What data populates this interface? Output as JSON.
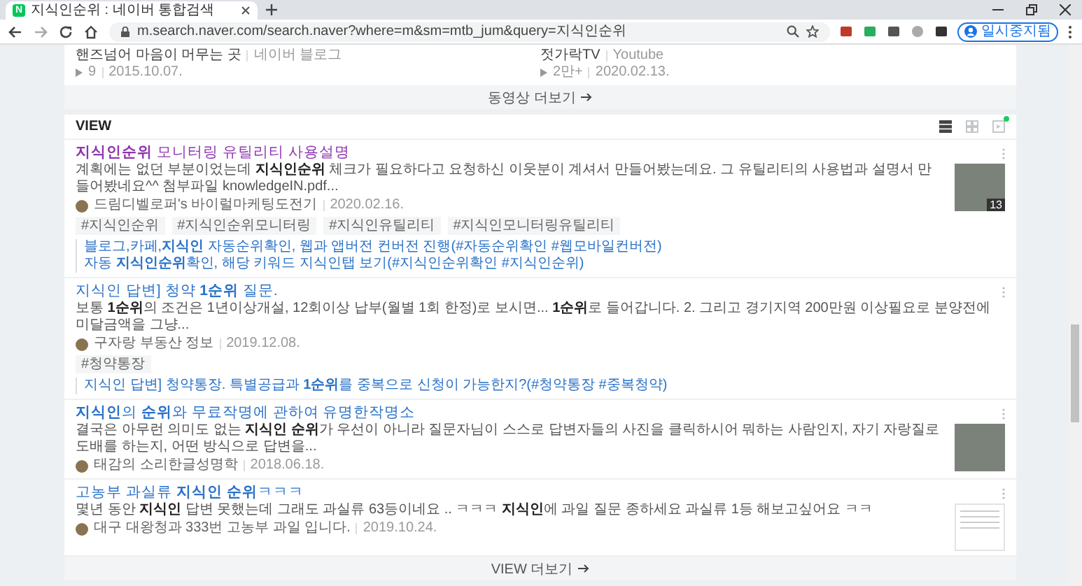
{
  "browser": {
    "tab": {
      "favicon": "N",
      "title": "지식인순위 : 네이버 통합검색"
    },
    "address": "m.search.naver.com/search.naver?where=m&sm=mtb_jum&query=지식인순위",
    "profile": "일시중지됨"
  },
  "video_results": {
    "items": [
      {
        "title": "핸즈넘어 마음이 머무는 곳",
        "source": "네이버 블로그",
        "plays": "9",
        "date": "2015.10.07."
      },
      {
        "title": "젓가락TV",
        "source": "Youtube",
        "plays": "2만+",
        "date": "2020.02.13."
      }
    ],
    "more_label": "동영상 더보기"
  },
  "view": {
    "title": "VIEW",
    "layout_modes": [
      {
        "kind": "list",
        "selected": true,
        "new": false
      },
      {
        "kind": "grid",
        "selected": false,
        "new": false
      },
      {
        "kind": "feed",
        "selected": false,
        "new": true
      }
    ],
    "items": [
      {
        "title": "**지식인순위** 모니터링 유틸리티 사용설명",
        "visited": true,
        "description": "계획에는 없던 부분이었는데 **지식인순위** 체크가 필요하다고 요청하신 이웃분이 계셔서 만들어봤는데요. 그 유틸리티의 사용법과 설명서 만들어봤네요^^ 첨부파일 knowledgeIN.pdf...",
        "author": "드림디벨로퍼's 바이럴마케팅도전기",
        "date": "2020.02.16.",
        "thumbnail": {
          "kind": "photo",
          "count": "13"
        },
        "tags": [
          "#지식인순위",
          "#지식인순위모니터링",
          "#지식인유틸리티",
          "#지식인모니터링유틸리티"
        ],
        "related": [
          "블로그,카페,**지식인** 자동순위확인, 웹과 앱버전 컨버전 진행(#자동순위확인 #웹모바일컨버전)",
          "자동 **지식인순위**확인, 해당 키워드 지식인탭 보기(#지식인순위확인 #지식인순위)"
        ]
      },
      {
        "title": "지식인 답변] 청약 **1순위** 질문.",
        "visited": false,
        "description": "보통 **1순위**의 조건은 1년이상개설, 12회이상 납부(월별 1회 한정)로 보시면... **1순위**로 들어갑니다. 2. 그리고 경기지역 200만원 이상필요로 분양전에 미달금액을 그냥...",
        "author": "구자랑 부동산 정보",
        "date": "2019.12.08.",
        "tags": [
          "#청약통장"
        ],
        "related": [
          "지식인 답변] 청약통장. 특별공급과 **1순위**를 중복으로 신청이 가능한지?(#청약통장 #중복청약)"
        ]
      },
      {
        "title": "**지식인**의 **순위**와 무료작명에 관하여 유명한작명소",
        "visited": false,
        "description": "결국은 아무런 의미도 없는 **지식인 순위**가 우선이 아니라 질문자님이 스스로 답변자들의 사진을 클릭하시어 뭐하는 사람인지, 자기 자랑질로 도배를 하는지, 어떤 방식으로 답변을...",
        "author": "태감의 소리한글성명학",
        "date": "2018.06.18.",
        "thumbnail": {
          "kind": "photo"
        }
      },
      {
        "title": "고농부 과실류 **지식인 순위**ㅋㅋㅋ",
        "visited": false,
        "description": "몇년 동안 **지식인** 답변 못했는데 그래도 과실류 63등이네요 .. ㅋㅋㅋ **지식인**에 과일 질문 종하세요 과실류 1등 해보고싶어요 ㅋㅋ",
        "author": "대구 대왕청과 333번 고농부 과일 입니다.",
        "date": "2019.10.24.",
        "thumbnail": {
          "kind": "screenshot"
        }
      }
    ],
    "more_label": "VIEW 더보기"
  }
}
